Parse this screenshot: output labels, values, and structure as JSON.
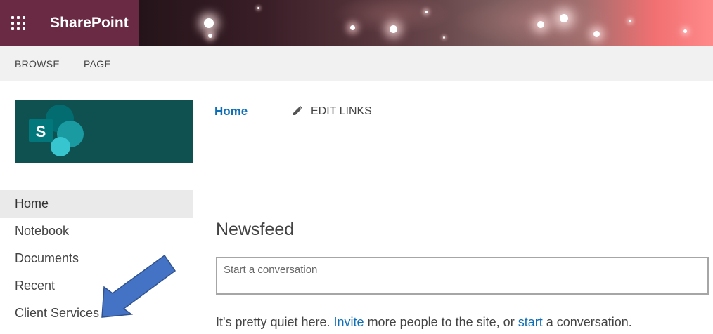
{
  "suite_bar": {
    "app_name": "SharePoint",
    "app_launcher_icon": "waffle-icon",
    "brand_color": "#6a2a44"
  },
  "ribbon": {
    "tabs": [
      "BROWSE",
      "PAGE"
    ]
  },
  "site_logo": {
    "icon": "sharepoint-logo-icon",
    "letter": "S",
    "background_color": "#0f5050"
  },
  "top_nav": {
    "home_label": "Home",
    "edit_links_label": "EDIT LINKS",
    "edit_icon": "pencil-icon"
  },
  "quick_launch": {
    "items": [
      {
        "label": "Home",
        "selected": true
      },
      {
        "label": "Notebook",
        "selected": false
      },
      {
        "label": "Documents",
        "selected": false
      },
      {
        "label": "Recent",
        "selected": false
      },
      {
        "label": "Client Services",
        "selected": false
      }
    ]
  },
  "newsfeed": {
    "title": "Newsfeed",
    "compose_placeholder": "Start a conversation",
    "quiet_prefix": "It's pretty quiet here. ",
    "invite_link": "Invite",
    "quiet_middle": " more people to the site, or ",
    "start_link": "start",
    "quiet_suffix": " a conversation."
  },
  "annotation": {
    "icon": "arrow-pointer-icon",
    "color": "#4472c4",
    "points_to": "Client Services"
  },
  "colors": {
    "link": "#0f6fb5",
    "ribbon_bg": "#f1f1f1",
    "selected_nav_bg": "#eaeaea"
  }
}
